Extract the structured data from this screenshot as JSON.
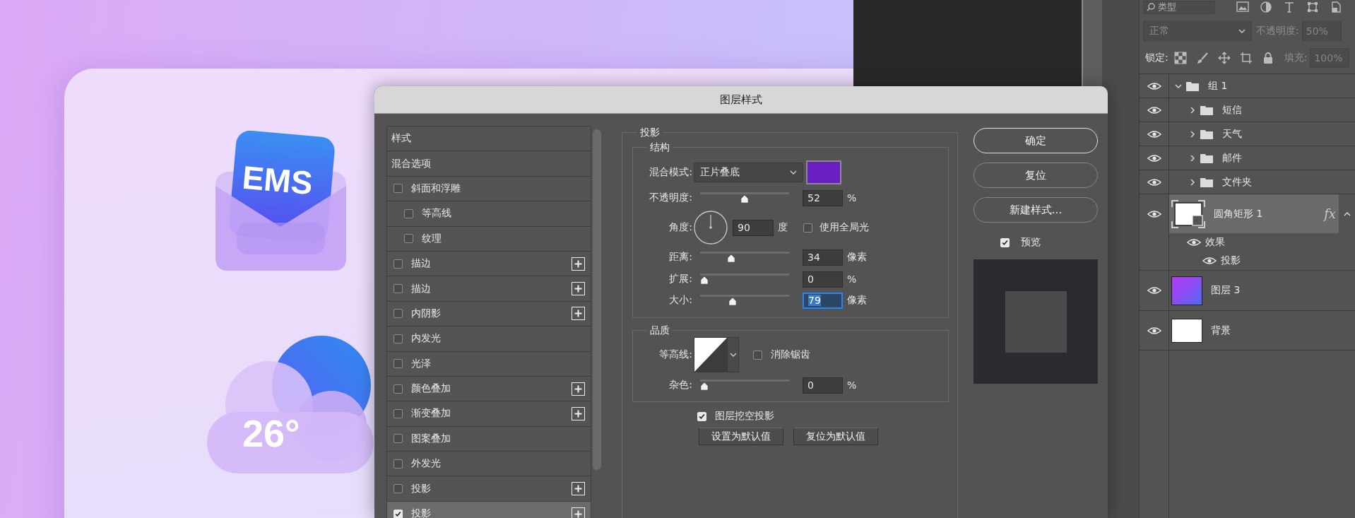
{
  "artwork": {
    "icons": [
      {
        "kind": "mail",
        "text": "EMS"
      },
      {
        "kind": "weather",
        "text": "26°"
      }
    ]
  },
  "dialog": {
    "title": "图层样式",
    "styles": [
      {
        "kind": "header",
        "label": "样式",
        "selected": false
      },
      {
        "kind": "header",
        "label": "混合选项",
        "selected": false
      },
      {
        "kind": "effect",
        "label": "斜面和浮雕",
        "checked": false,
        "selected": false,
        "add": false,
        "children": [
          {
            "kind": "effect",
            "label": "等高线",
            "checked": false,
            "selected": false,
            "add": false
          },
          {
            "kind": "effect",
            "label": "纹理",
            "checked": false,
            "selected": false,
            "add": false
          }
        ]
      },
      {
        "kind": "effect",
        "label": "描边",
        "checked": false,
        "selected": false,
        "add": true
      },
      {
        "kind": "effect",
        "label": "描边",
        "checked": false,
        "selected": false,
        "add": true
      },
      {
        "kind": "effect",
        "label": "内阴影",
        "checked": false,
        "selected": false,
        "add": true
      },
      {
        "kind": "effect",
        "label": "内发光",
        "checked": false,
        "selected": false,
        "add": false
      },
      {
        "kind": "effect",
        "label": "光泽",
        "checked": false,
        "selected": false,
        "add": false
      },
      {
        "kind": "effect",
        "label": "颜色叠加",
        "checked": false,
        "selected": false,
        "add": true
      },
      {
        "kind": "effect",
        "label": "渐变叠加",
        "checked": false,
        "selected": false,
        "add": true
      },
      {
        "kind": "effect",
        "label": "图案叠加",
        "checked": false,
        "selected": false,
        "add": false
      },
      {
        "kind": "effect",
        "label": "外发光",
        "checked": false,
        "selected": false,
        "add": false
      },
      {
        "kind": "effect",
        "label": "投影",
        "checked": false,
        "selected": false,
        "add": true
      },
      {
        "kind": "effect",
        "label": "投影",
        "checked": true,
        "selected": true,
        "add": true
      }
    ],
    "shadow": {
      "title": "投影",
      "structure": {
        "title": "结构",
        "rows": [
          {
            "kind": "select",
            "label": "混合模式:",
            "value": "正片叠底",
            "color": "#6a1fc2"
          },
          {
            "kind": "slider",
            "label": "不透明度:",
            "level": 0.5,
            "value": "52",
            "unit": "%",
            "focused": false
          },
          {
            "kind": "angle",
            "label": "角度:",
            "value": "90",
            "unit": "度",
            "option": {
              "label": "使用全局光",
              "checked": false
            }
          },
          {
            "kind": "slider",
            "label": "距离:",
            "level": 0.33,
            "value": "34",
            "unit": "像素",
            "focused": false
          },
          {
            "kind": "slider",
            "label": "扩展:",
            "level": 0,
            "value": "0",
            "unit": "%",
            "focused": false
          },
          {
            "kind": "slider",
            "label": "大小:",
            "level": 0.35,
            "value": "79",
            "unit": "像素",
            "focused": true
          }
        ]
      },
      "quality": {
        "title": "品质",
        "rows": [
          {
            "kind": "contour",
            "label": "等高线:",
            "option": {
              "label": "消除锯齿",
              "checked": false
            }
          },
          {
            "kind": "slider",
            "label": "杂色:",
            "level": 0,
            "value": "0",
            "unit": "%",
            "focused": false
          }
        ]
      },
      "knockout": {
        "label": "图层挖空投影",
        "checked": true
      },
      "buttons": [
        "设置为默认值",
        "复位为默认值"
      ]
    },
    "actions": [
      {
        "label": "确定",
        "default": true
      },
      {
        "label": "复位",
        "default": false
      },
      {
        "label": "新建样式...",
        "default": false
      }
    ],
    "preview": {
      "label": "预览",
      "checked": true
    }
  },
  "layers_panel": {
    "filter": "类型",
    "blend_mode": {
      "value": "正常",
      "disabled": true
    },
    "opacity": {
      "label": "不透明度:",
      "value": "50%",
      "disabled": true
    },
    "lock": {
      "label": "锁定:"
    },
    "fill": {
      "label": "填充:",
      "value": "100%",
      "disabled": true
    },
    "layers": [
      {
        "kind": "group",
        "name": "组 1",
        "visible": true,
        "expanded": true,
        "selected": false,
        "children": [
          {
            "kind": "group",
            "name": "短信",
            "visible": true,
            "expanded": false,
            "selected": false
          },
          {
            "kind": "group",
            "name": "天气",
            "visible": true,
            "expanded": false,
            "selected": false
          },
          {
            "kind": "group",
            "name": "邮件",
            "visible": true,
            "expanded": false,
            "selected": false
          },
          {
            "kind": "group",
            "name": "文件夹",
            "visible": true,
            "expanded": false,
            "selected": false
          }
        ]
      },
      {
        "kind": "shape",
        "name": "圆角矩形 1",
        "visible": true,
        "selected": true,
        "fx": "fx",
        "expanded": true,
        "effects": [
          {
            "label": "效果",
            "visible": true,
            "children": [
              {
                "label": "投影",
                "visible": true
              }
            ]
          }
        ]
      },
      {
        "kind": "pixel",
        "name": "图层 3",
        "visible": true,
        "selected": false
      },
      {
        "kind": "background",
        "name": "背景",
        "visible": true,
        "selected": false
      }
    ]
  }
}
